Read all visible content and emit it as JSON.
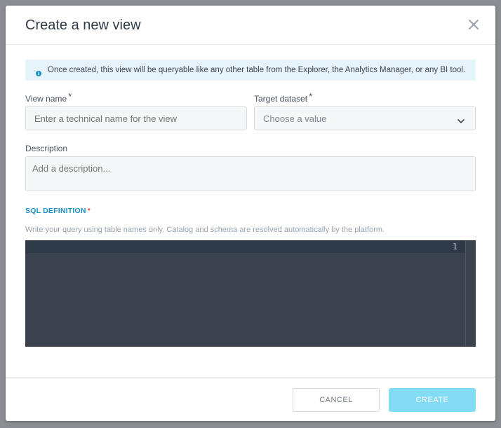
{
  "modal": {
    "title": "Create a new view",
    "close_icon": "close-icon"
  },
  "info": {
    "icon": "info-icon",
    "text": "Once created, this view will be queryable like any other table from the Explorer, the Analytics Manager, or any BI tool."
  },
  "view_name": {
    "label": "View name",
    "required_mark": "*",
    "placeholder": "Enter a technical name for the view",
    "value": ""
  },
  "target_dataset": {
    "label": "Target dataset",
    "required_mark": "*",
    "placeholder": "Choose a value",
    "icon": "chevron-down-icon"
  },
  "description": {
    "label": "Description",
    "placeholder": "Add a description...",
    "value": ""
  },
  "sql": {
    "label": "SQL DEFINITION",
    "required_mark": "*",
    "hint": "Write your query using table names only. Catalog and schema are resolved automatically by the platform.",
    "line_numbers": [
      "1"
    ],
    "content": ""
  },
  "footer": {
    "cancel_label": "CANCEL",
    "create_label": "CREATE"
  },
  "colors": {
    "accent": "#1c8fc4",
    "create_button": "#84dcf4",
    "info_background": "#e5f4fb",
    "editor_background": "#3b424d"
  }
}
